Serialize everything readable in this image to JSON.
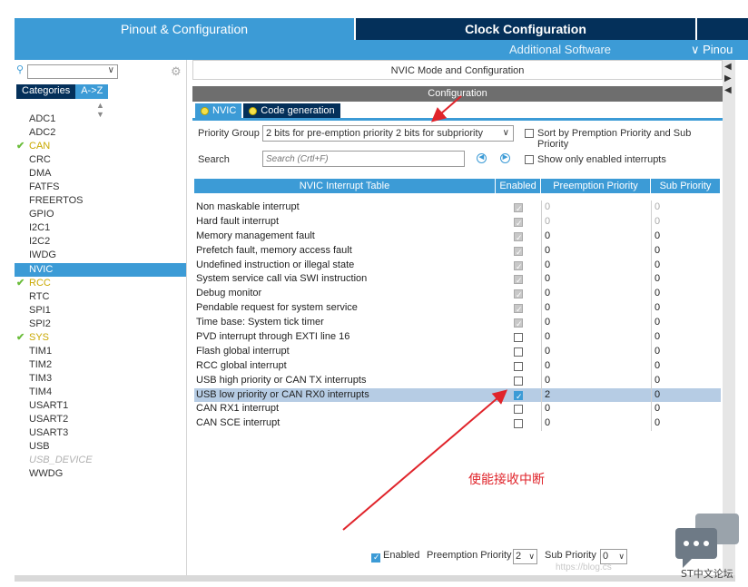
{
  "tabs": {
    "pinout": "Pinout & Configuration",
    "clock": "Clock Configuration",
    "additional": "Additional Software",
    "pinout_view": "∨ Pinou"
  },
  "left": {
    "categories_label": "Categories",
    "az_label": "A->Z",
    "items": [
      {
        "label": "ADC1",
        "state": "normal"
      },
      {
        "label": "ADC2",
        "state": "normal"
      },
      {
        "label": "CAN",
        "state": "ok"
      },
      {
        "label": "CRC",
        "state": "normal"
      },
      {
        "label": "DMA",
        "state": "normal"
      },
      {
        "label": "FATFS",
        "state": "normal"
      },
      {
        "label": "FREERTOS",
        "state": "normal"
      },
      {
        "label": "GPIO",
        "state": "normal"
      },
      {
        "label": "I2C1",
        "state": "normal"
      },
      {
        "label": "I2C2",
        "state": "normal"
      },
      {
        "label": "IWDG",
        "state": "normal"
      },
      {
        "label": "NVIC",
        "state": "selected"
      },
      {
        "label": "RCC",
        "state": "ok"
      },
      {
        "label": "RTC",
        "state": "normal"
      },
      {
        "label": "SPI1",
        "state": "normal"
      },
      {
        "label": "SPI2",
        "state": "normal"
      },
      {
        "label": "SYS",
        "state": "ok"
      },
      {
        "label": "TIM1",
        "state": "normal"
      },
      {
        "label": "TIM2",
        "state": "normal"
      },
      {
        "label": "TIM3",
        "state": "normal"
      },
      {
        "label": "TIM4",
        "state": "normal"
      },
      {
        "label": "USART1",
        "state": "normal"
      },
      {
        "label": "USART2",
        "state": "normal"
      },
      {
        "label": "USART3",
        "state": "normal"
      },
      {
        "label": "USB",
        "state": "normal"
      },
      {
        "label": "USB_DEVICE",
        "state": "disabled"
      },
      {
        "label": "WWDG",
        "state": "normal"
      }
    ]
  },
  "right": {
    "mode_title": "NVIC Mode and Configuration",
    "config_title": "Configuration",
    "tab_nvic": "NVIC",
    "tab_codegen": "Code generation",
    "priority_group_label": "Priority Group",
    "priority_group_value": "2 bits for pre-emption priority 2 bits for subpriority",
    "sort_label": "Sort by Premption Priority and Sub Priority",
    "search_label": "Search",
    "search_placeholder": "Search (Crtl+F)",
    "show_enabled_label": "Show only enabled interrupts",
    "columns": [
      "NVIC Interrupt Table",
      "Enabled",
      "Preemption Priority",
      "Sub Priority"
    ],
    "rows": [
      {
        "name": "Non maskable interrupt",
        "enabled": "fixed",
        "pp": "0",
        "sp": "0",
        "muted": true
      },
      {
        "name": "Hard fault interrupt",
        "enabled": "fixed",
        "pp": "0",
        "sp": "0",
        "muted": true
      },
      {
        "name": "Memory management fault",
        "enabled": "fixed",
        "pp": "0",
        "sp": "0",
        "muted": false
      },
      {
        "name": "Prefetch fault, memory access fault",
        "enabled": "fixed",
        "pp": "0",
        "sp": "0",
        "muted": false
      },
      {
        "name": "Undefined instruction or illegal state",
        "enabled": "fixed",
        "pp": "0",
        "sp": "0",
        "muted": false
      },
      {
        "name": "System service call via SWI instruction",
        "enabled": "fixed",
        "pp": "0",
        "sp": "0",
        "muted": false
      },
      {
        "name": "Debug monitor",
        "enabled": "fixed",
        "pp": "0",
        "sp": "0",
        "muted": false
      },
      {
        "name": "Pendable request for system service",
        "enabled": "fixed",
        "pp": "0",
        "sp": "0",
        "muted": false
      },
      {
        "name": "Time base: System tick timer",
        "enabled": "fixed",
        "pp": "0",
        "sp": "0",
        "muted": false
      },
      {
        "name": "PVD interrupt through EXTI line 16",
        "enabled": "off",
        "pp": "0",
        "sp": "0",
        "muted": false
      },
      {
        "name": "Flash global interrupt",
        "enabled": "off",
        "pp": "0",
        "sp": "0",
        "muted": false
      },
      {
        "name": "RCC global interrupt",
        "enabled": "off",
        "pp": "0",
        "sp": "0",
        "muted": false
      },
      {
        "name": "USB high priority or CAN TX interrupts",
        "enabled": "off",
        "pp": "0",
        "sp": "0",
        "muted": false
      },
      {
        "name": "USB low priority or CAN RX0 interrupts",
        "enabled": "on",
        "pp": "2",
        "sp": "0",
        "muted": false,
        "selected": true
      },
      {
        "name": "CAN RX1 interrupt",
        "enabled": "off",
        "pp": "0",
        "sp": "0",
        "muted": false
      },
      {
        "name": "CAN SCE interrupt",
        "enabled": "off",
        "pp": "0",
        "sp": "0",
        "muted": false
      }
    ],
    "annotation": "使能接收中断",
    "bottom": {
      "enabled_label": "Enabled",
      "pp_label": "Preemption Priority",
      "pp_value": "2",
      "sp_label": "Sub Priority",
      "sp_value": "0"
    }
  },
  "watermark": "https://blog.cs",
  "badge_text": "ST中文论坛",
  "colors": {
    "accent": "#3c9bd6",
    "dark": "#04305a",
    "annotation": "#e0242b"
  }
}
